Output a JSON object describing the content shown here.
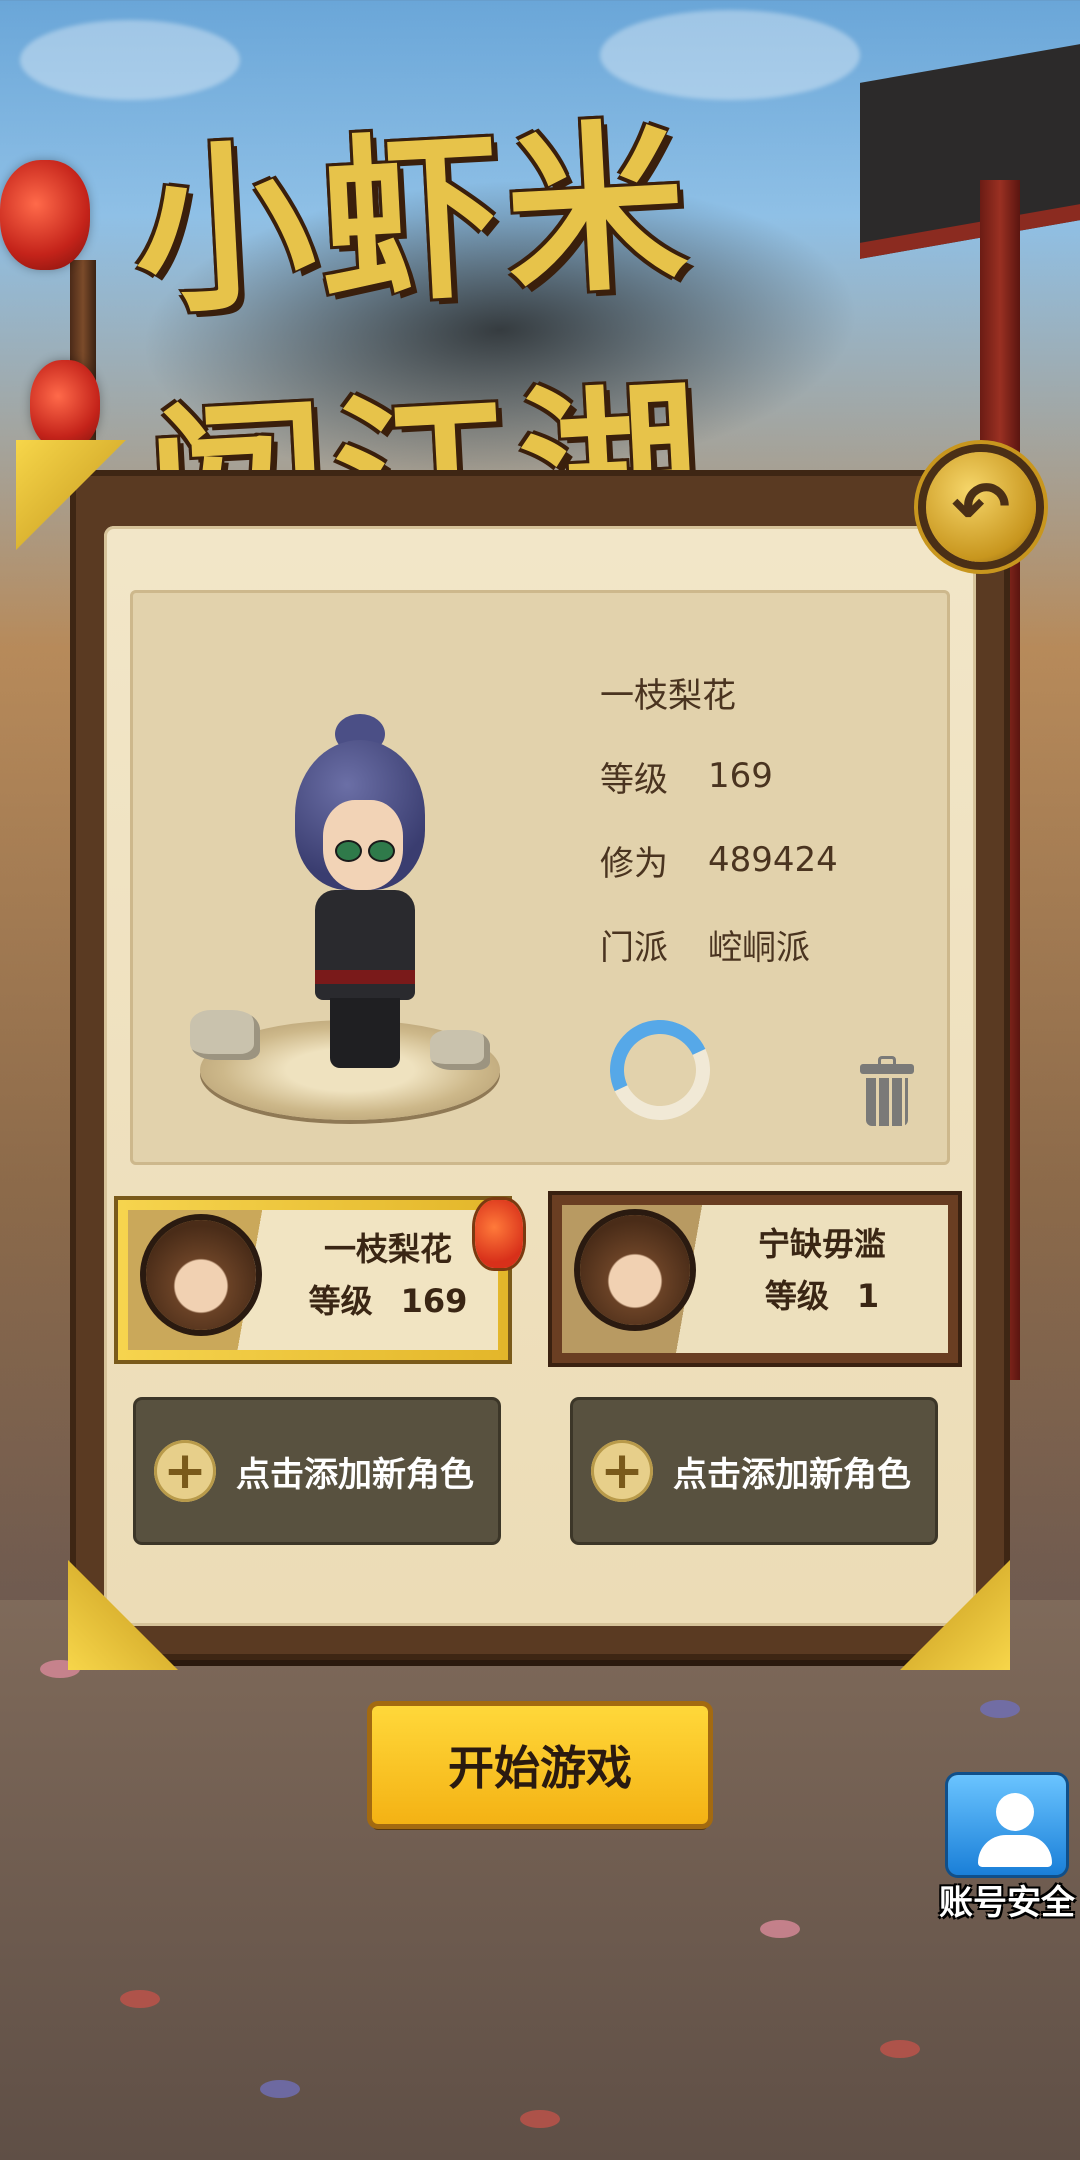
{
  "game": {
    "logo_text": "小虾米闯江湖"
  },
  "selected_character": {
    "name": "一枝梨花",
    "level_label": "等级",
    "level": "169",
    "cultivation_label": "修为",
    "cultivation": "489424",
    "sect_label": "门派",
    "sect": "崆峒派"
  },
  "slots": [
    {
      "name": "一枝梨花",
      "level_label": "等级",
      "level": "169",
      "selected": true
    },
    {
      "name": "宁缺毋滥",
      "level_label": "等级",
      "level": "1",
      "selected": false
    }
  ],
  "add_slots": [
    {
      "label": "点击添加新角色"
    },
    {
      "label": "点击添加新角色"
    }
  ],
  "buttons": {
    "start": "开始游戏",
    "account_security": "账号安全",
    "back_icon": "↶"
  },
  "colors": {
    "gold": "#f4b214",
    "panel_brown": "#5a3a22",
    "parchment": "#f2e6c8",
    "account_blue": "#1a7fd8"
  }
}
